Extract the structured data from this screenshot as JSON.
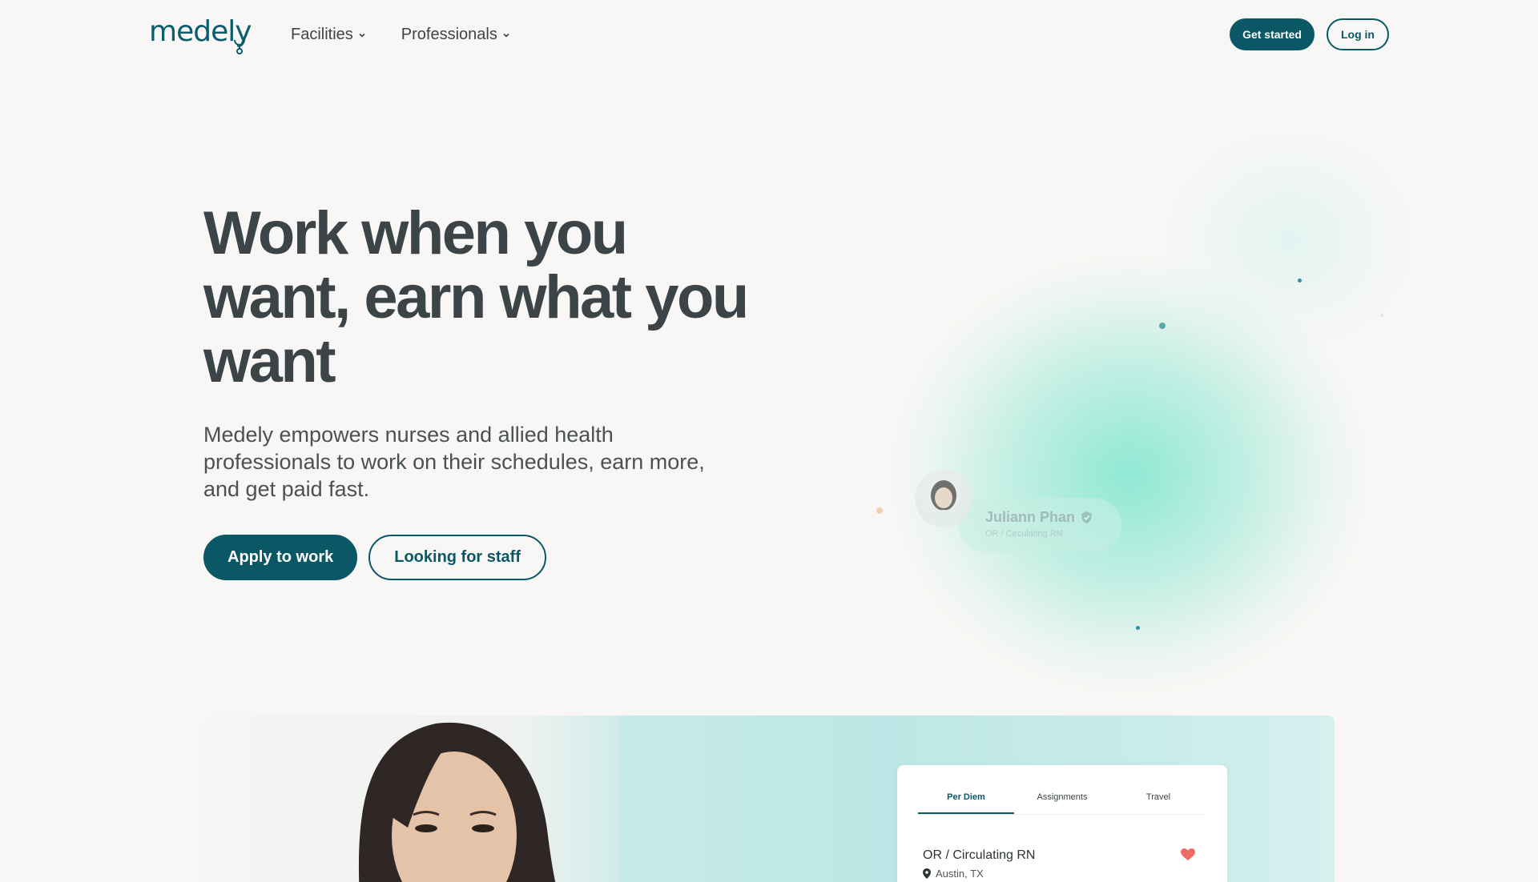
{
  "brand": {
    "logo_text": "medely",
    "accent": "#0a5866",
    "glow": "#86e6d0"
  },
  "nav": {
    "links": [
      {
        "label": "Facilities",
        "icon": "chevron-down-icon"
      },
      {
        "label": "Professionals",
        "icon": "chevron-down-icon"
      }
    ],
    "get_started": "Get started",
    "log_in": "Log in"
  },
  "hero": {
    "title": "Work when you want, earn what you want",
    "subtitle": "Medely empowers nurses and allied health professionals to work on their schedules, earn more, and get paid fast.",
    "primary_cta": "Apply to work",
    "secondary_cta": "Looking for staff"
  },
  "profile_card": {
    "name": "Juliann Phan",
    "role": "OR / Circulating RN",
    "verified_icon": "verified-check-icon"
  },
  "job_card": {
    "tabs": [
      "Per Diem",
      "Assignments",
      "Travel"
    ],
    "active_tab": "Per Diem",
    "job_title": "OR / Circulating RN",
    "location": "Austin, TX",
    "location_icon": "location-pin-icon",
    "favorite_icon": "heart-icon"
  }
}
